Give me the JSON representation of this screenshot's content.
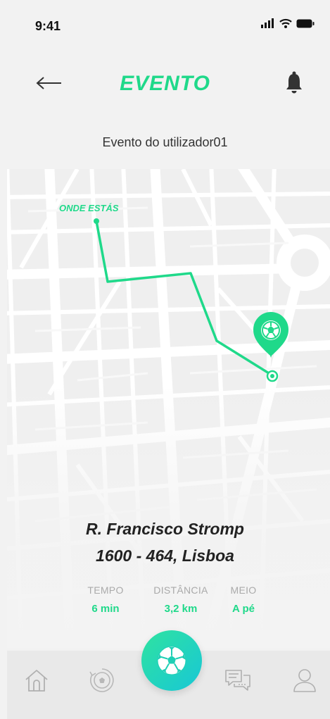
{
  "status_bar": {
    "time": "9:41",
    "icons": [
      "signal-icon",
      "wifi-icon",
      "battery-icon"
    ]
  },
  "header": {
    "title": "EVENTO",
    "back_icon": "arrow-left-icon",
    "bell_icon": "bell-icon",
    "subtitle": "Evento do utilizador01"
  },
  "map": {
    "you_label": "ONDE ESTÁS",
    "destination_icon": "soccer-ball-pin-icon",
    "route_color": "#1fd98a"
  },
  "destination": {
    "address_line1": "R. Francisco Stromp",
    "address_line2": "1600 - 464, Lisboa"
  },
  "stats": [
    {
      "label": "TEMPO",
      "value": "6 min"
    },
    {
      "label": "DISTÂNCIA",
      "value": "3,2 km"
    },
    {
      "label": "MEIO",
      "value": "A pé"
    }
  ],
  "bottom_nav": {
    "items": [
      "home-icon",
      "history-ball-icon",
      "soccer-ball-icon",
      "chat-icon",
      "profile-icon"
    ],
    "active": "soccer-ball-icon"
  },
  "colors": {
    "accent": "#1fd98a",
    "accent_gradient_end": "#18c7d6",
    "background": "#f2f2f2"
  }
}
